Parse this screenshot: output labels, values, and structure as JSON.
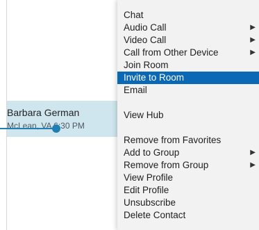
{
  "contact": {
    "name": "Barbara German",
    "status": "McLean, VA 6:30 PM"
  },
  "menu": {
    "items": [
      {
        "label": "Chat",
        "submenu": false,
        "selected": false
      },
      {
        "label": "Audio Call",
        "submenu": true,
        "selected": false
      },
      {
        "label": "Video Call",
        "submenu": true,
        "selected": false
      },
      {
        "label": "Call from Other Device",
        "submenu": true,
        "selected": false
      },
      {
        "label": "Join Room",
        "submenu": false,
        "selected": false
      },
      {
        "label": "Invite to Room",
        "submenu": false,
        "selected": true
      },
      {
        "label": "Email",
        "submenu": false,
        "selected": false
      },
      {
        "label": "View Hub",
        "submenu": false,
        "selected": false
      },
      {
        "label": "Remove from Favorites",
        "submenu": false,
        "selected": false
      },
      {
        "label": "Add to Group",
        "submenu": true,
        "selected": false
      },
      {
        "label": "Remove from Group",
        "submenu": true,
        "selected": false
      },
      {
        "label": "View Profile",
        "submenu": false,
        "selected": false
      },
      {
        "label": "Edit Profile",
        "submenu": false,
        "selected": false
      },
      {
        "label": "Unsubscribe",
        "submenu": false,
        "selected": false
      },
      {
        "label": "Delete Contact",
        "submenu": false,
        "selected": false
      }
    ],
    "submenu_arrow": "▶"
  },
  "colors": {
    "selected_bg": "#0a68b5",
    "row_highlight": "#cfe6ee",
    "pointer": "#1f7fb3"
  },
  "icons": {
    "submenu": "submenu-arrow-icon"
  }
}
